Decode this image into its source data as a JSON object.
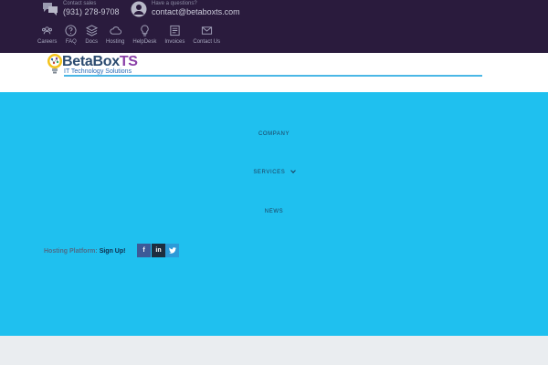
{
  "topbar": {
    "sales_label": "Contact sales",
    "sales_phone": "(931) 278-9708",
    "mail_label": "Have a questions?",
    "mail_address": "contact@betaboxts.com",
    "links": [
      {
        "label": "Careers",
        "icon": "users-icon"
      },
      {
        "label": "FAQ",
        "icon": "question-icon"
      },
      {
        "label": "Docs",
        "icon": "layers-icon"
      },
      {
        "label": "Hosting",
        "icon": "cloud-icon"
      },
      {
        "label": "HelpDesk",
        "icon": "lightbulb-icon"
      },
      {
        "label": "Invoices",
        "icon": "invoice-icon"
      },
      {
        "label": "Contact Us",
        "icon": "envelope-icon"
      }
    ]
  },
  "header": {
    "logo_main": "BetaBox",
    "logo_suffix": "TS",
    "logo_tagline": "IT Technology Solutions"
  },
  "nav": {
    "company": "COMPANY",
    "services": "SERVICES",
    "news": "NEWS"
  },
  "main": {
    "hosting_label": "Hosting Platform:",
    "signup": "Sign Up!"
  },
  "social": {
    "facebook": "f",
    "linkedin": "in",
    "twitter": "t"
  },
  "colors": {
    "topbar_bg": "#2a1b3d",
    "main_bg": "#1fc0ef",
    "footer_bg": "#eaedf0",
    "logo_purple": "#8a3fa7",
    "accent_blue": "#4ab7e6"
  }
}
